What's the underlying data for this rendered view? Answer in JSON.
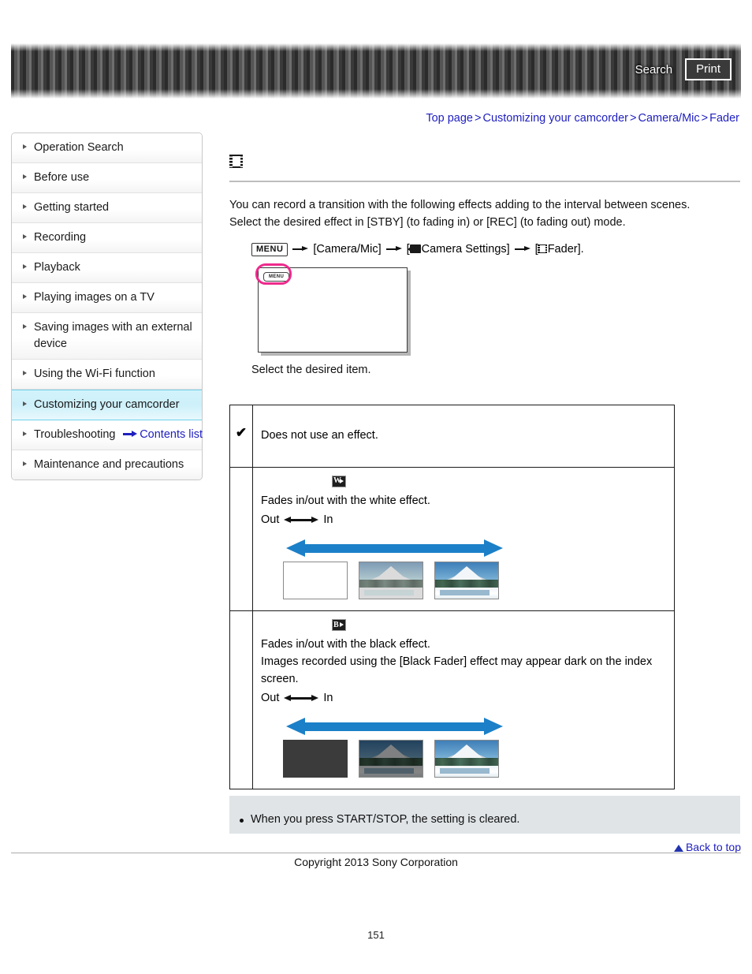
{
  "header": {
    "search_label": "Search",
    "print_label": "Print"
  },
  "breadcrumb": {
    "items": [
      "Top page",
      "Customizing your camcorder",
      "Camera/Mic",
      "Fader"
    ],
    "separator": ">"
  },
  "sidebar": {
    "items": [
      {
        "label": "Operation Search",
        "active": false
      },
      {
        "label": "Before use",
        "active": false
      },
      {
        "label": "Getting started",
        "active": false
      },
      {
        "label": "Recording",
        "active": false
      },
      {
        "label": "Playback",
        "active": false
      },
      {
        "label": "Playing images on a TV",
        "active": false
      },
      {
        "label": "Saving images with an external device",
        "active": false
      },
      {
        "label": "Using the Wi-Fi function",
        "active": false
      },
      {
        "label": "Customizing your camcorder",
        "active": true
      },
      {
        "label": "Troubleshooting",
        "active": false
      },
      {
        "label": "Maintenance and precautions",
        "active": false
      }
    ],
    "contents_list_label": "Contents list"
  },
  "main": {
    "title_icon": "movie-film-icon",
    "intro_line1": "You can record a transition with the following effects adding to the interval between scenes.",
    "intro_line2": "Select the desired effect in [STBY] (to fading in) or [REC] (to fading out) mode.",
    "menu_path": {
      "menu_chip": "MENU",
      "step1": "[Camera/Mic]",
      "step2_open": "[",
      "step2": "Camera Settings]",
      "step3_open": "[",
      "step3": "Fader]."
    },
    "screen_illustration": {
      "mini_menu_label": "MENU",
      "highlight_color": "#ee2a8c"
    },
    "caption": "Select the desired item.",
    "table": {
      "rows": [
        {
          "checked": true,
          "check_glyph": "✔",
          "badge": null,
          "badge_letter": null,
          "lines": [
            "Does not use an effect."
          ],
          "out_label": null,
          "in_label": null,
          "thumbs": null
        },
        {
          "checked": false,
          "check_glyph": "",
          "badge": "white-fader-icon",
          "badge_letter": "W",
          "lines": [
            "Fades in/out with the white effect."
          ],
          "out_label": "Out",
          "in_label": "In",
          "thumbs": [
            "blank-white-frame",
            "washed-out-mountain",
            "mountain-scene"
          ]
        },
        {
          "checked": false,
          "check_glyph": "",
          "badge": "black-fader-icon",
          "badge_letter": "B",
          "lines": [
            "Fades in/out with the black effect.",
            "Images recorded using the [Black Fader] effect may appear dark on the index screen."
          ],
          "out_label": "Out",
          "in_label": "In",
          "thumbs": [
            "black-frame",
            "darkened-mountain",
            "mountain-scene"
          ]
        }
      ]
    }
  },
  "note": {
    "bullet_text": "When you press START/STOP, the setting is cleared."
  },
  "footer": {
    "back_to_top": "Back to top",
    "copyright": "Copyright 2013 Sony Corporation",
    "page_number": "151"
  },
  "colors": {
    "link": "#2020c0",
    "accent_highlight": "#ee2a8c",
    "arrow_blue": "#1b80c8",
    "sidebar_active": "#cdf0fa",
    "note_bg": "#e0e4e7"
  }
}
